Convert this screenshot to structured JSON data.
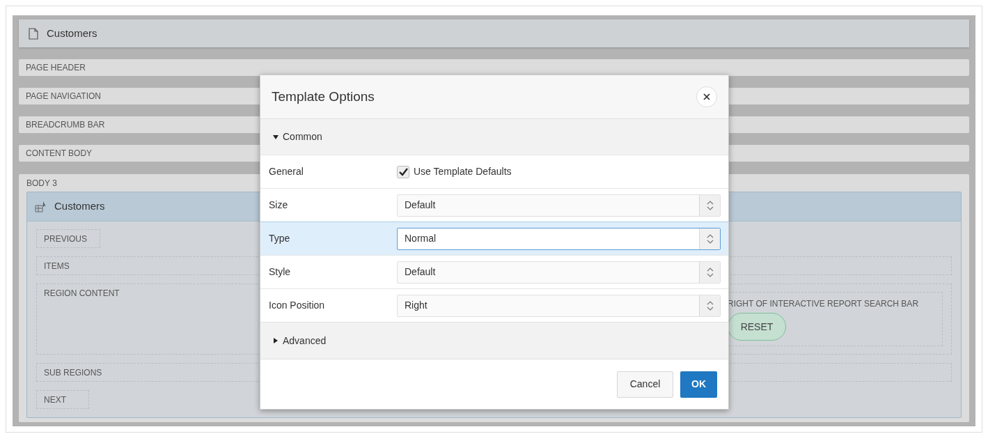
{
  "page": {
    "title": "Customers",
    "sections": [
      "PAGE HEADER",
      "PAGE NAVIGATION",
      "BREADCRUMB BAR",
      "CONTENT BODY"
    ],
    "body": {
      "label": "BODY 3",
      "region": {
        "title": "Customers",
        "previous": "PREVIOUS",
        "items": "ITEMS",
        "region_content": "REGION CONTENT",
        "right_of_search_bar": "RIGHT OF INTERACTIVE REPORT SEARCH BAR",
        "reset_button": "RESET",
        "sub_regions": "SUB REGIONS",
        "next": "NEXT"
      }
    }
  },
  "dialog": {
    "title": "Template Options",
    "sections": [
      {
        "label": "Common",
        "expanded": true,
        "rows": [
          {
            "kind": "checkbox",
            "label": "General",
            "option": "Use Template Defaults",
            "checked": true,
            "selected": false
          },
          {
            "kind": "select",
            "label": "Size",
            "value": "Default",
            "selected": false
          },
          {
            "kind": "select",
            "label": "Type",
            "value": "Normal",
            "selected": true
          },
          {
            "kind": "select",
            "label": "Style",
            "value": "Default",
            "selected": false
          },
          {
            "kind": "select",
            "label": "Icon Position",
            "value": "Right",
            "selected": false
          }
        ]
      },
      {
        "label": "Advanced",
        "expanded": false
      }
    ],
    "buttons": [
      {
        "label": "Cancel",
        "kind": "secondary"
      },
      {
        "label": "OK",
        "kind": "primary"
      }
    ]
  }
}
